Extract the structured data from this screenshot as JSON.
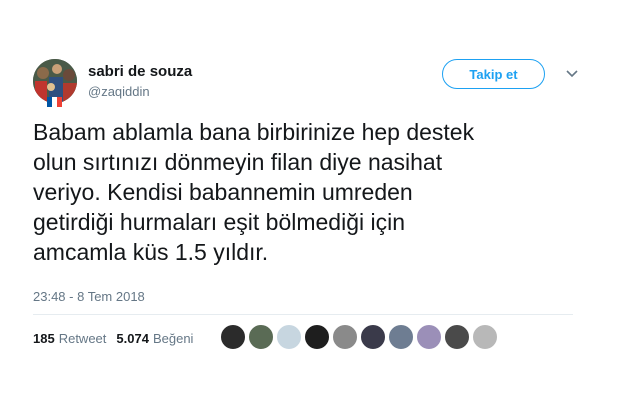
{
  "user": {
    "display_name": "sabri de souza",
    "handle": "@zaqiddin",
    "avatar_icon": "profile-photo",
    "flag_icon": "french-flag"
  },
  "follow_button": {
    "label": "Takip et"
  },
  "tweet": {
    "text": "Babam ablamla bana birbirinize hep destek\nolun sırtınızı dönmeyin filan diye nasihat\nveriyo. Kendisi babannemin umreden\ngetirdiği hurmaları eşit bölmediği için\namcamla küs 1.5 yıldır.",
    "timestamp": "23:48 - 8 Tem 2018"
  },
  "stats": {
    "retweet_count": "185",
    "retweet_label": "Retweet",
    "like_count": "5.074",
    "like_label": "Beğeni"
  },
  "likers": [
    {
      "color": "#2b2b2b"
    },
    {
      "color": "#5a6b55"
    },
    {
      "color": "#c7d6e0"
    },
    {
      "color": "#1e1e1e"
    },
    {
      "color": "#8a8a8a"
    },
    {
      "color": "#3a3a4a"
    },
    {
      "color": "#6e7d92"
    },
    {
      "color": "#9b8fb8"
    },
    {
      "color": "#4a4a4a"
    },
    {
      "color": "#b8b8b8"
    }
  ],
  "colors": {
    "accent": "#1da1f2",
    "secondary_text": "#657786",
    "primary_text": "#14171a",
    "divider": "#e6ecf0"
  }
}
